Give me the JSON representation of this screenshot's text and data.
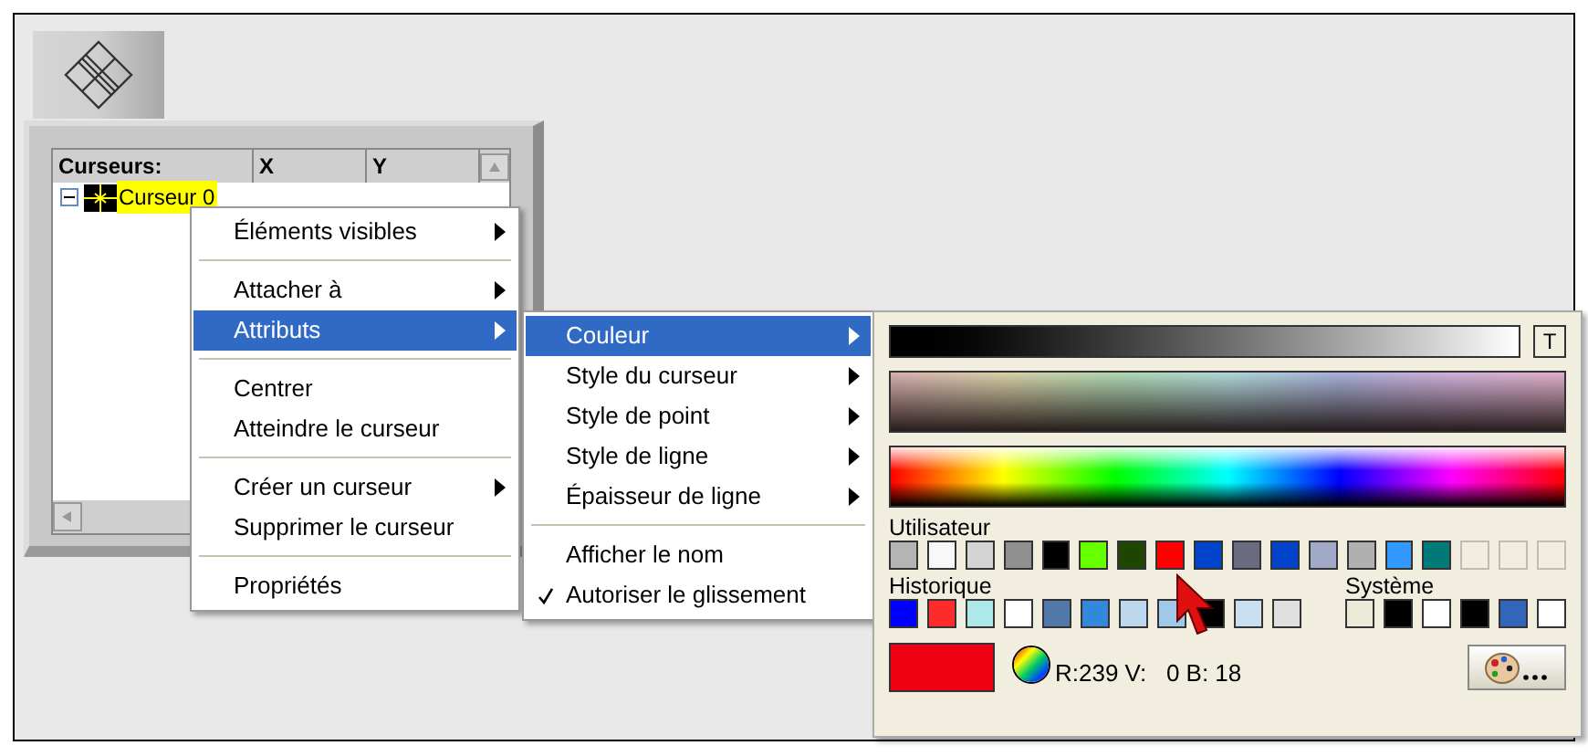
{
  "cursor_table": {
    "columns": [
      "Curseurs:",
      "X",
      "Y"
    ],
    "rows": [
      {
        "name": "Curseur 0",
        "selected": true,
        "expanded": true
      }
    ]
  },
  "context_menu": {
    "groups": [
      [
        {
          "label": "Éléments visibles",
          "submenu": true,
          "selected": false
        }
      ],
      [
        {
          "label": "Attacher à",
          "submenu": true,
          "selected": false
        },
        {
          "label": "Attributs",
          "submenu": true,
          "selected": true
        }
      ],
      [
        {
          "label": "Centrer",
          "submenu": false,
          "selected": false
        },
        {
          "label": "Atteindre le curseur",
          "submenu": false,
          "selected": false
        }
      ],
      [
        {
          "label": "Créer un curseur",
          "submenu": true,
          "selected": false
        },
        {
          "label": "Supprimer le curseur",
          "submenu": false,
          "selected": false
        }
      ],
      [
        {
          "label": "Propriétés",
          "submenu": false,
          "selected": false
        }
      ]
    ]
  },
  "attributes_menu": {
    "groups": [
      [
        {
          "label": "Couleur",
          "submenu": true,
          "selected": true,
          "checked": false
        },
        {
          "label": "Style du curseur",
          "submenu": true,
          "selected": false,
          "checked": false
        },
        {
          "label": "Style de point",
          "submenu": true,
          "selected": false,
          "checked": false
        },
        {
          "label": "Style de ligne",
          "submenu": true,
          "selected": false,
          "checked": false
        },
        {
          "label": "Épaisseur de ligne",
          "submenu": true,
          "selected": false,
          "checked": false
        }
      ],
      [
        {
          "label": "Afficher le nom",
          "submenu": false,
          "selected": false,
          "checked": false
        },
        {
          "label": "Autoriser le glissement",
          "submenu": false,
          "selected": false,
          "checked": true
        }
      ]
    ]
  },
  "color_picker": {
    "transparent_button": "T",
    "user": {
      "label": "Utilisateur",
      "swatches": [
        {
          "color": "#b4b4b4"
        },
        {
          "color": "#f8f8f8"
        },
        {
          "color": "#d4d4d4"
        },
        {
          "color": "#909090"
        },
        {
          "color": "#000000"
        },
        {
          "color": "#66ff00"
        },
        {
          "color": "#1e4600"
        },
        {
          "color": "#ff0000"
        },
        {
          "color": "#0044cc"
        },
        {
          "color": "#6a6a80"
        },
        {
          "color": "#0044cc"
        },
        {
          "color": "#a0aac8"
        },
        {
          "color": "#b0b0b0"
        },
        {
          "color": "#3399ff"
        },
        {
          "color": "#007a78"
        },
        {
          "kind": "empty"
        },
        {
          "kind": "empty"
        },
        {
          "kind": "empty"
        }
      ]
    },
    "history": {
      "label": "Historique",
      "swatches": [
        {
          "color": "#0000ff"
        },
        {
          "color": "#ff2a2a"
        },
        {
          "color": "#aee8e8"
        },
        {
          "color": "#ffffff"
        },
        {
          "color": "#5078a8"
        },
        {
          "color": "#3388dd"
        },
        {
          "color": "#bcd8ee"
        },
        {
          "color": "#a0c8e8"
        },
        {
          "color": "#000000"
        },
        {
          "color": "#c8e0f0"
        },
        {
          "color": "#e0e0e0"
        }
      ]
    },
    "system": {
      "label": "Système",
      "swatches": [
        {
          "color": "#ece9d8"
        },
        {
          "color": "#000000"
        },
        {
          "color": "#ffffff"
        },
        {
          "color": "#000000"
        },
        {
          "color": "#3366bb"
        },
        {
          "color": "#ffffff"
        }
      ]
    },
    "current": {
      "color": "#ef0012"
    },
    "reading": "R:239 V:   0 B: 18"
  }
}
